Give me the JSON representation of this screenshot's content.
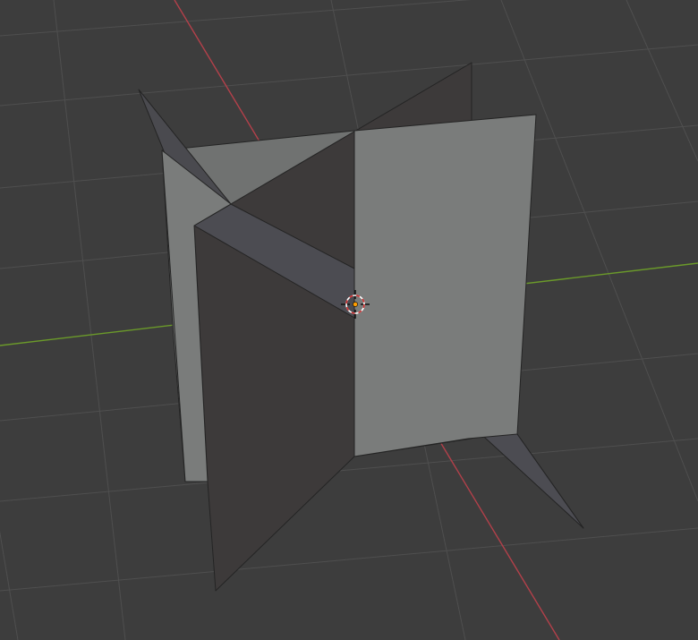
{
  "viewport": {
    "background": "#3d3d3d",
    "grid_color": "#4f4f4f",
    "axis_x_color": "#b3404a",
    "axis_y_color": "#6b9a2a",
    "edge_color": "#242424"
  },
  "scene": {
    "object_count": 3,
    "objects": [
      {
        "shape": "plane",
        "facing": "light",
        "color": "#7a7c7b"
      },
      {
        "shape": "plane",
        "facing": "dark",
        "color": "#3d3a3a"
      },
      {
        "shape": "plane",
        "facing": "diagonal",
        "color": "#4a4a4f"
      }
    ]
  },
  "cursor": {
    "icon": "3d-cursor-icon",
    "ring_color_a": "#d03030",
    "ring_color_b": "#ffffff",
    "origin_color": "#ff9d00"
  }
}
